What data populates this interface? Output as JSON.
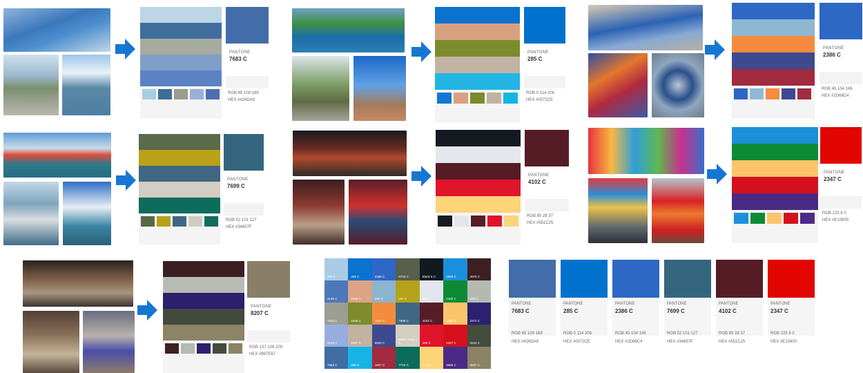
{
  "brand": "PANTONE",
  "groups": [
    {
      "code": "7683 C",
      "rgb": "RGB  65 109 169",
      "hex": "HEX #426DA9",
      "main": "#426DA9",
      "stripes": [
        "#bcd6e6",
        "#3f6d9c",
        "#a7aca0",
        "#7f9fc9",
        "#5b83c4"
      ],
      "chips": [
        "#a6cde0",
        "#3c6d98",
        "#9a9c8e",
        "#9bb0d8",
        "#4c6fb0"
      ]
    },
    {
      "code": "285 C",
      "rgb": "RGB  0 114 206",
      "hex": "HEX #0072CE",
      "main": "#0072CE",
      "stripes": [
        "#0a72cf",
        "#d9a080",
        "#7c8b2b",
        "#c2b3a3",
        "#22b5e4"
      ],
      "chips": [
        "#1577d1",
        "#d9a083",
        "#7d8a2c",
        "#c2b2a0",
        "#16b4e5"
      ]
    },
    {
      "code": "2386 C",
      "rgb": "RGB  45 104 196",
      "hex": "HEX #2D68C4",
      "main": "#2D68C4",
      "stripes": [
        "#2f67c5",
        "#8eb7d1",
        "#f58b3f",
        "#3e4a8f",
        "#a12b3f"
      ],
      "chips": [
        "#2e66c4",
        "#92b9d3",
        "#f58c40",
        "#3b4a92",
        "#a02b40"
      ]
    },
    {
      "code": "7699 C",
      "rgb": "RGB  52 101 127",
      "hex": "HEX #34657F",
      "main": "#34657F",
      "stripes": [
        "#5a6a4b",
        "#b9a218",
        "#3f6781",
        "#d3cdc3",
        "#0d6d5d"
      ],
      "chips": [
        "#58684a",
        "#b8a01a",
        "#3f6782",
        "#d1cbc1",
        "#0f6d5e"
      ]
    },
    {
      "code": "4102 C",
      "rgb": "RGB  85 28 37",
      "hex": "HEX #551C25",
      "main": "#551C25",
      "stripes": [
        "#131a22",
        "#e4e7ec",
        "#551c25",
        "#e0142b",
        "#fed479"
      ],
      "chips": [
        "#161c24",
        "#e2e6ec",
        "#571d27",
        "#df152c",
        "#fcd47b"
      ]
    },
    {
      "code": "2347 C",
      "rgb": "RGB  225 6 0",
      "hex": "HEX #E10600",
      "main": "#E10600",
      "stripes": [
        "#1c8fd9",
        "#0e8a35",
        "#fcc56b",
        "#d4101d",
        "#4b2a85"
      ],
      "chips": [
        "#1e90db",
        "#0f8a37",
        "#fbc46a",
        "#d4111e",
        "#4c2b87"
      ]
    },
    {
      "code": "8207 C",
      "rgb": "RGB  137 126 100",
      "hex": "HEX #897E67",
      "main": "#897E67",
      "stripes": [
        "#3b1e22",
        "#b6bcb4",
        "#2c1f6b",
        "#424b3c",
        "#8b8467"
      ],
      "chips": [
        "#3d2024",
        "#b4bab2",
        "#2d206d",
        "#434c3d",
        "#8a8366"
      ]
    }
  ],
  "grid": {
    "rows": [
      [
        {
          "l": "290 C",
          "c": "#a9cbe5"
        },
        {
          "l": "285 C",
          "c": "#0a72cf"
        },
        {
          "l": "2386 C",
          "c": "#2f67c5"
        },
        {
          "l": "5743 C",
          "c": "#56604a"
        },
        {
          "l": "Black 6 C",
          "c": "#121920"
        },
        {
          "l": "2925 C",
          "c": "#1a90dc"
        },
        {
          "l": "4975 C",
          "c": "#3d1f22"
        }
      ],
      [
        {
          "l": "2145 C",
          "c": "#4d77b9"
        },
        {
          "l": "2486 C",
          "c": "#dca384"
        },
        {
          "l": "550 C",
          "c": "#8ab4cf"
        },
        {
          "l": "457 C",
          "c": "#b5a21a"
        },
        {
          "l": "656 C",
          "c": "#e2e6ec"
        },
        {
          "l": "2425 C",
          "c": "#0e8a37"
        },
        {
          "l": "420 C",
          "c": "#b4bab3"
        }
      ],
      [
        {
          "l": "7538 C",
          "c": "#9c9e91"
        },
        {
          "l": "2308 C",
          "c": "#7d8b2c"
        },
        {
          "l": "1657 C",
          "c": "#f58b3f"
        },
        {
          "l": "7699 C",
          "c": "#3f6882"
        },
        {
          "l": "4102 C",
          "c": "#571d27"
        },
        {
          "l": "1355 C",
          "c": "#fbc56b"
        },
        {
          "l": "2372 C",
          "c": "#2c2070"
        }
      ],
      [
        {
          "l": "2128 C",
          "c": "#97ade0"
        },
        {
          "l": "4007 C",
          "c": "#c2b2a0"
        },
        {
          "l": "5503 C",
          "c": "#3d4a90"
        },
        {
          "l": "Warm Gray 1 C",
          "c": "#d4cec3"
        },
        {
          "l": "185 C",
          "c": "#e0142b"
        },
        {
          "l": "2347 C",
          "c": "#d5111e"
        },
        {
          "l": "4224 C",
          "c": "#434c3d"
        }
      ],
      [
        {
          "l": "7683 C",
          "c": "#3f6da5"
        },
        {
          "l": "306 C",
          "c": "#15b4e5"
        },
        {
          "l": "1807 C",
          "c": "#a12b3f"
        },
        {
          "l": "7720 C",
          "c": "#0d6b5c"
        },
        {
          "l": "134 C",
          "c": "#fed479"
        },
        {
          "l": "2685 C",
          "c": "#4b2a85"
        },
        {
          "l": "8207 C",
          "c": "#8a8366"
        }
      ]
    ]
  },
  "summary": [
    {
      "code": "7683 C",
      "rgb": "RGB  65 109 169",
      "hex": "HEX #426DA9",
      "c": "#426DA9"
    },
    {
      "code": "285 C",
      "rgb": "RGB  0 114 206",
      "hex": "HEX #0072CE",
      "c": "#0072CE"
    },
    {
      "code": "2386 C",
      "rgb": "RGB  45 104 196",
      "hex": "HEX #2D68C4",
      "c": "#2D68C4"
    },
    {
      "code": "7699 C",
      "rgb": "RGB  52 101 127",
      "hex": "HEX #34657F",
      "c": "#34657F"
    },
    {
      "code": "4102 C",
      "rgb": "RGB  85 28 37",
      "hex": "HEX #551C25",
      "c": "#551C25"
    },
    {
      "code": "2347 C",
      "rgb": "RGB  225 6 0",
      "hex": "HEX #E10600",
      "c": "#E10600"
    }
  ],
  "colors": {
    "arrow": "#1677d2"
  }
}
